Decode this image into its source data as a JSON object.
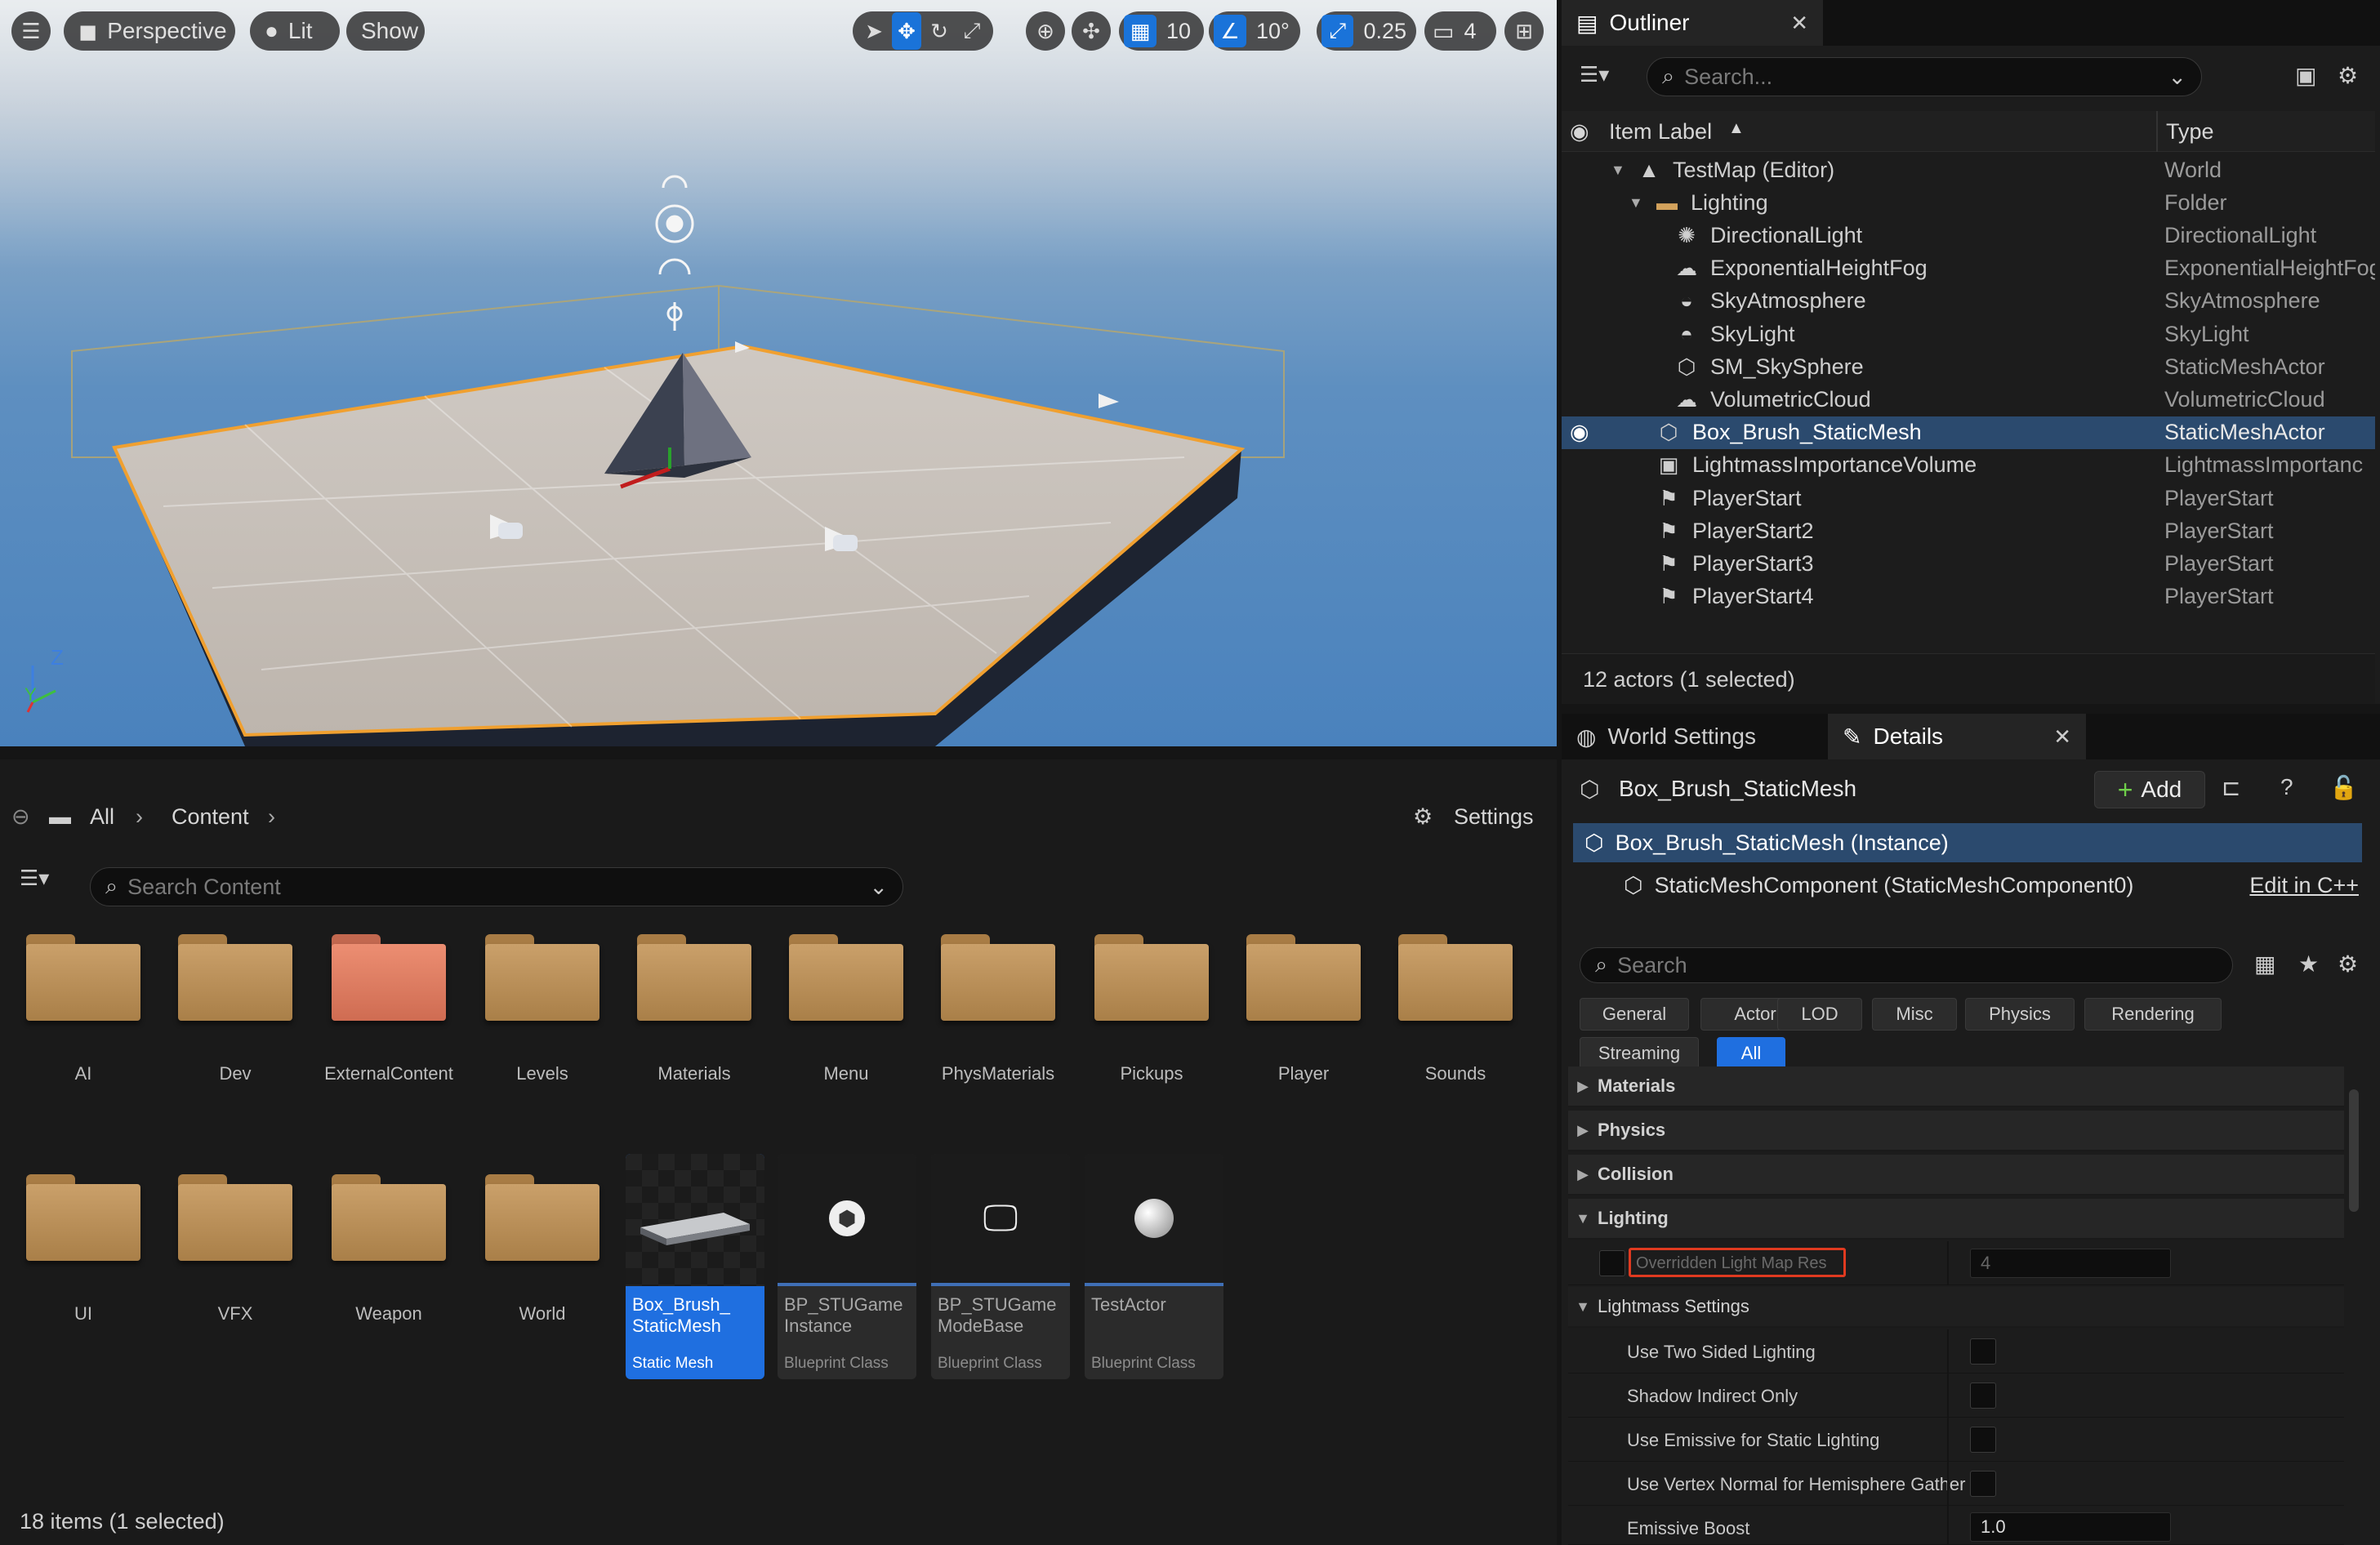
{
  "viewport": {
    "view_mode": "Perspective",
    "lighting_mode": "Lit",
    "show_label": "Show",
    "grid_snap": "10",
    "rotation_snap": "10°",
    "scale_snap": "0.25",
    "camera_speed": "4",
    "axis_z": "Z",
    "axis_y": "Y"
  },
  "outliner": {
    "tab_title": "Outliner",
    "search_placeholder": "Search...",
    "col_label": "Item Label",
    "col_type": "Type",
    "items": [
      {
        "label": "TestMap (Editor)",
        "type": "World",
        "icon": "world-icon"
      },
      {
        "label": "Lighting",
        "type": "Folder",
        "icon": "folder-icon"
      },
      {
        "label": "DirectionalLight",
        "type": "DirectionalLight",
        "icon": "sun-icon"
      },
      {
        "label": "ExponentialHeightFog",
        "type": "ExponentialHeightFog",
        "icon": "fog-icon"
      },
      {
        "label": "SkyAtmosphere",
        "type": "SkyAtmosphere",
        "icon": "atmosphere-icon"
      },
      {
        "label": "SkyLight",
        "type": "SkyLight",
        "icon": "skylight-icon"
      },
      {
        "label": "SM_SkySphere",
        "type": "StaticMeshActor",
        "icon": "mesh-icon"
      },
      {
        "label": "VolumetricCloud",
        "type": "VolumetricCloud",
        "icon": "cloud-icon"
      },
      {
        "label": "Box_Brush_StaticMesh",
        "type": "StaticMeshActor",
        "icon": "mesh-icon"
      },
      {
        "label": "LightmassImportanceVolume",
        "type": "LightmassImportanc",
        "icon": "volume-icon"
      },
      {
        "label": "PlayerStart",
        "type": "PlayerStart",
        "icon": "player-start-icon"
      },
      {
        "label": "PlayerStart2",
        "type": "PlayerStart",
        "icon": "player-start-icon"
      },
      {
        "label": "PlayerStart3",
        "type": "PlayerStart",
        "icon": "player-start-icon"
      },
      {
        "label": "PlayerStart4",
        "type": "PlayerStart",
        "icon": "player-start-icon"
      }
    ],
    "status": "12 actors (1 selected)"
  },
  "content_browser": {
    "breadcrumb_all": "All",
    "breadcrumb_content": "Content",
    "settings_label": "Settings",
    "search_placeholder": "Search Content",
    "folders": [
      "AI",
      "Dev",
      "ExternalContent",
      "Levels",
      "Materials",
      "Menu",
      "PhysMaterials",
      "Pickups",
      "Player",
      "Sounds",
      "UI",
      "VFX",
      "Weapon",
      "World"
    ],
    "assets": [
      {
        "name": "Box_Brush_\nStaticMesh",
        "class": "Static Mesh"
      },
      {
        "name": "BP_STUGame\nInstance",
        "class": "Blueprint Class"
      },
      {
        "name": "BP_STUGame\nModeBase",
        "class": "Blueprint Class"
      },
      {
        "name": "TestActor",
        "class": "Blueprint Class"
      }
    ],
    "status": "18 items (1 selected)"
  },
  "details": {
    "tab_world_settings": "World Settings",
    "tab_details": "Details",
    "actor_name": "Box_Brush_StaticMesh",
    "add_label": "Add",
    "instance_label": "Box_Brush_StaticMesh (Instance)",
    "component_label": "StaticMeshComponent (StaticMeshComponent0)",
    "edit_cpp": "Edit in C++",
    "search_placeholder": "Search",
    "filters_row1": [
      "General",
      "Actor",
      "LOD",
      "Misc",
      "Physics",
      "Rendering"
    ],
    "filters_row2": [
      "Streaming",
      "All"
    ],
    "categories": {
      "materials": "Materials",
      "physics": "Physics",
      "collision": "Collision",
      "lighting": "Lighting",
      "lightmass": "Lightmass Settings"
    },
    "props": {
      "overridden_lightmap": "Overridden Light Map Res",
      "overridden_lightmap_value": "4",
      "two_sided": "Use Two Sided Lighting",
      "shadow_indirect": "Shadow Indirect Only",
      "emissive_static": "Use Emissive for Static Lighting",
      "vertex_normal": "Use Vertex Normal for Hemisphere Gather",
      "emissive_boost": "Emissive Boost",
      "emissive_boost_value": "1.0"
    }
  },
  "colors": {
    "accent": "#1f6fe0",
    "selection_row": "#2b4a6e",
    "folder": "#c39a63",
    "folder_red": "#e0806a",
    "highlight_box": "#e03a20"
  }
}
